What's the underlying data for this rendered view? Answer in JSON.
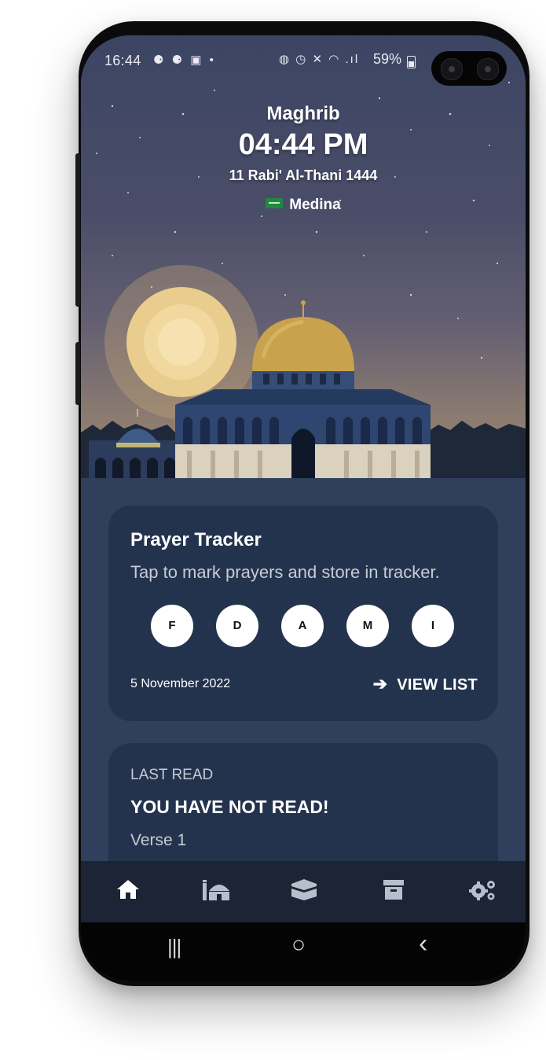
{
  "status_bar": {
    "time": "16:44",
    "left_icons": "⚈ ⚈ ▣ •",
    "right_icons": "◍ ◷ ✕ ◠ .ıl",
    "battery": "59%"
  },
  "header": {
    "prayer_name": "Maghrib",
    "prayer_time": "04:44 PM",
    "hijri_date": "11 Rabi' Al-Thani 1444",
    "location": "Medina"
  },
  "prayer_tracker": {
    "title": "Prayer Tracker",
    "subtitle": "Tap to mark prayers and store in tracker.",
    "prayers": [
      "F",
      "D",
      "A",
      "M",
      "I"
    ],
    "date": "5 November 2022",
    "view_list_label": "VIEW LIST"
  },
  "last_read": {
    "label": "LAST READ",
    "title": "YOU HAVE NOT READ!",
    "verse": "Verse 1"
  },
  "bottom_nav": {
    "items": [
      {
        "icon": "home-icon"
      },
      {
        "icon": "mosque-icon"
      },
      {
        "icon": "kaaba-icon"
      },
      {
        "icon": "archive-icon"
      },
      {
        "icon": "settings-gears-icon"
      }
    ]
  },
  "system_nav": {
    "recents": "|||",
    "home": "○",
    "back": "‹"
  },
  "colors": {
    "background": "#2f3f5c",
    "card": "#24334d",
    "nav_bar": "#1c2435"
  }
}
